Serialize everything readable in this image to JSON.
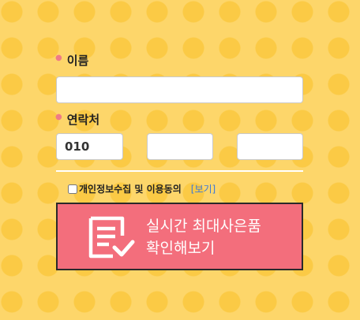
{
  "form": {
    "name_label": "이름",
    "name_value": "",
    "phone_label": "연락처",
    "phone_first": "010",
    "phone_middle": "",
    "phone_last": "",
    "privacy_label": "개인정보수집 및 이용동의",
    "privacy_view_link": "[보기]",
    "privacy_checked": false
  },
  "cta": {
    "line1": "실시간 최대사은품",
    "line2": "확인해보기",
    "icon": "document-check-icon"
  },
  "colors": {
    "background": "#fdd66a",
    "dots": "#fbca45",
    "bullet": "#f07b86",
    "cta_background": "#f36e7c",
    "link": "#3b78d8"
  }
}
